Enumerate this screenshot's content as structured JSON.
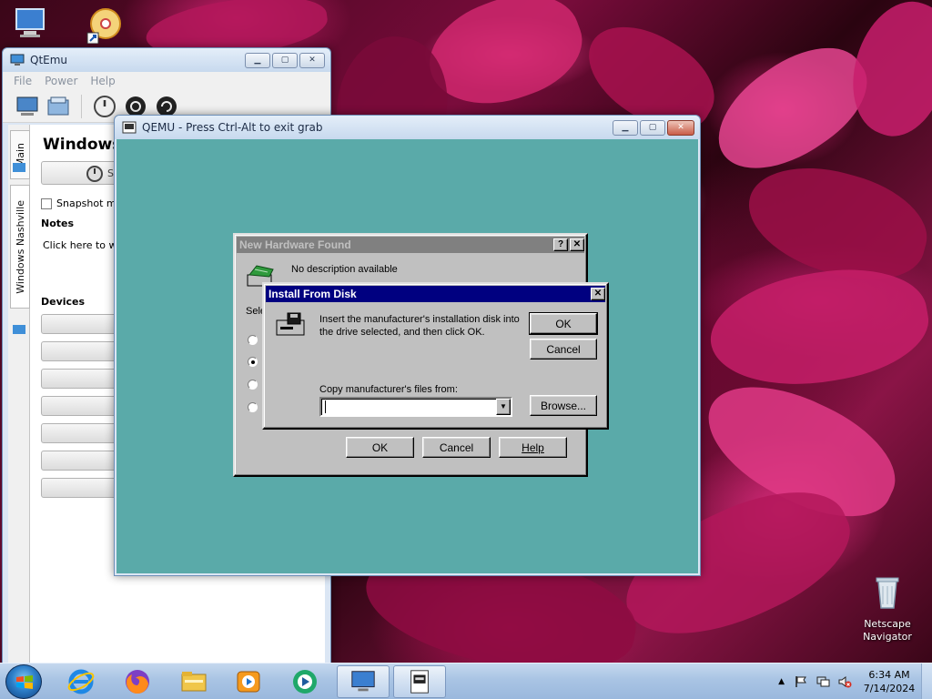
{
  "desktop": {
    "icons": [
      {
        "name": "computer-icon",
        "label": ""
      },
      {
        "name": "disc-shortcut-icon",
        "label": ""
      },
      {
        "name": "recycle-bin-icon",
        "label": "Netscape Navigator"
      }
    ]
  },
  "qtemu": {
    "title": "QtEmu",
    "menu": [
      "File",
      "Power",
      "Help"
    ],
    "tabs": {
      "main": "Main",
      "vm": "Windows Nashville"
    },
    "vm_title": "Windows",
    "start_label": "St",
    "snapshot_label": "Snapshot mo",
    "notes_heading": "Notes",
    "notes_placeholder": "Click here to writ",
    "devices_heading": "Devices"
  },
  "qemu": {
    "title": "QEMU - Press Ctrl-Alt to exit grab"
  },
  "new_hardware": {
    "title": "New Hardware Found",
    "help_btn": "?",
    "close_btn": "✕",
    "description": "No description available",
    "select_label": "Sele",
    "radio_selected_index": 1,
    "ok": "OK",
    "cancel": "Cancel",
    "help": "Help"
  },
  "install_disk": {
    "title": "Install From Disk",
    "close_btn": "✕",
    "message_line1": "Insert the manufacturer's installation disk into",
    "message_line2": "the drive selected, and then click OK.",
    "ok": "OK",
    "cancel": "Cancel",
    "copy_label": "Copy manufacturer's files from:",
    "path_value": "",
    "browse": "Browse..."
  },
  "taskbar": {
    "pinned": [
      "internet-explorer-icon",
      "firefox-icon",
      "file-explorer-icon",
      "media-player-icon",
      "qtemu-app-icon"
    ],
    "running": [
      "qemu-window-icon",
      "disk-window-icon"
    ],
    "clock_time": "6:34 AM",
    "clock_date": "7/14/2024",
    "tray_arrow": "▲"
  },
  "colors": {
    "guest_desktop": "#5aaaa9",
    "win95_title_active": "#000080",
    "win95_face": "#c0c0c0"
  }
}
